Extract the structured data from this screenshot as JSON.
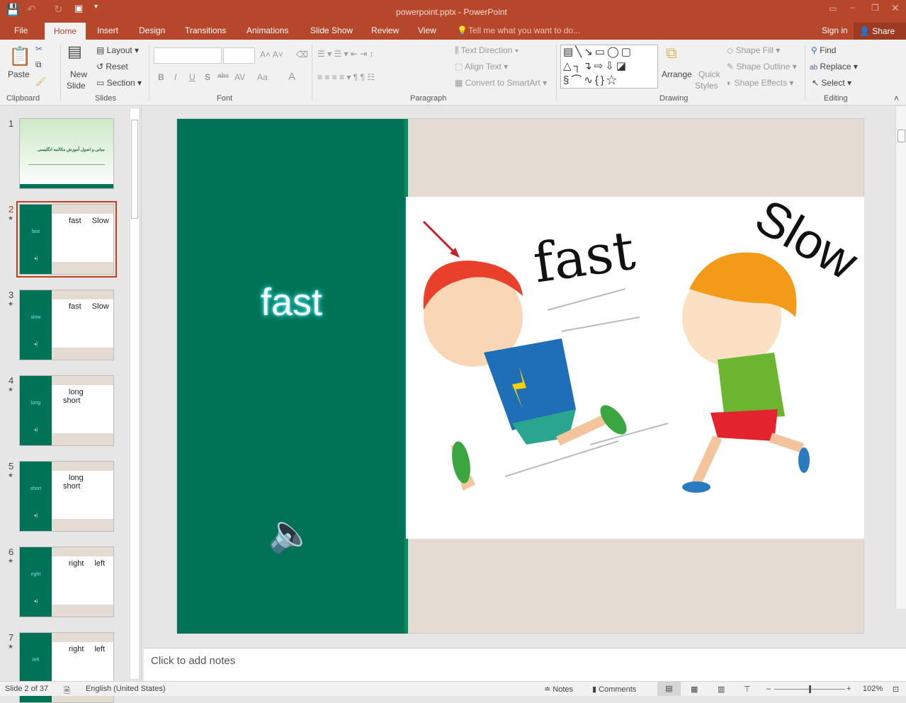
{
  "window": {
    "title": "powerpoint.pptx - PowerPoint"
  },
  "tabs": [
    "File",
    "Home",
    "Insert",
    "Design",
    "Transitions",
    "Animations",
    "Slide Show",
    "Review",
    "View"
  ],
  "tell_me": "Tell me what you want to do...",
  "sign_in": "Sign in",
  "share": "Share",
  "ribbon": {
    "clipboard": {
      "paste": "Paste",
      "label": "Clipboard"
    },
    "slides": {
      "new_slide_1": "New",
      "new_slide_2": "Slide",
      "layout": "Layout",
      "reset": "Reset",
      "section": "Section",
      "label": "Slides"
    },
    "font": {
      "label": "Font",
      "bold": "B",
      "italic": "I",
      "underline": "U",
      "shadow": "S",
      "strike": "abc",
      "spacing": "AV",
      "case": "Aa",
      "color": "A"
    },
    "paragraph": {
      "label": "Paragraph",
      "text_direction": "Text Direction",
      "align_text": "Align Text",
      "smartart": "Convert to SmartArt"
    },
    "drawing": {
      "label": "Drawing",
      "arrange": "Arrange",
      "quick_1": "Quick",
      "quick_2": "Styles",
      "shape_fill": "Shape Fill",
      "shape_outline": "Shape Outline",
      "shape_effects": "Shape Effects"
    },
    "editing": {
      "label": "Editing",
      "find": "Find",
      "replace": "Replace",
      "select": "Select"
    }
  },
  "thumbnails": [
    {
      "num": "1",
      "label": "",
      "title": "مبانی و اصول آموزش مکالمه انگلیسی"
    },
    {
      "num": "2",
      "label": "fast",
      "w1": "fast",
      "w2": "Slow"
    },
    {
      "num": "3",
      "label": "slow",
      "w1": "fast",
      "w2": "Slow"
    },
    {
      "num": "4",
      "label": "long",
      "w1": "long",
      "w2": "short"
    },
    {
      "num": "5",
      "label": "short",
      "w1": "long",
      "w2": "short"
    },
    {
      "num": "6",
      "label": "right",
      "w1": "right",
      "w2": "left"
    },
    {
      "num": "7",
      "label": "left",
      "w1": "right",
      "w2": "left"
    }
  ],
  "slide": {
    "word": "fast",
    "image_word_1": "fast",
    "image_word_2": "Slow"
  },
  "notes_placeholder": "Click to add notes",
  "status": {
    "slide": "Slide 2 of 37",
    "language": "English (United States)",
    "notes": "Notes",
    "comments": "Comments",
    "zoom": "102%",
    "zoom_level": 102
  },
  "colors": {
    "accent": "#b7472a",
    "slide_green": "#007356",
    "slide_bg": "#e4dcd2",
    "word": "#7fe0e6"
  }
}
